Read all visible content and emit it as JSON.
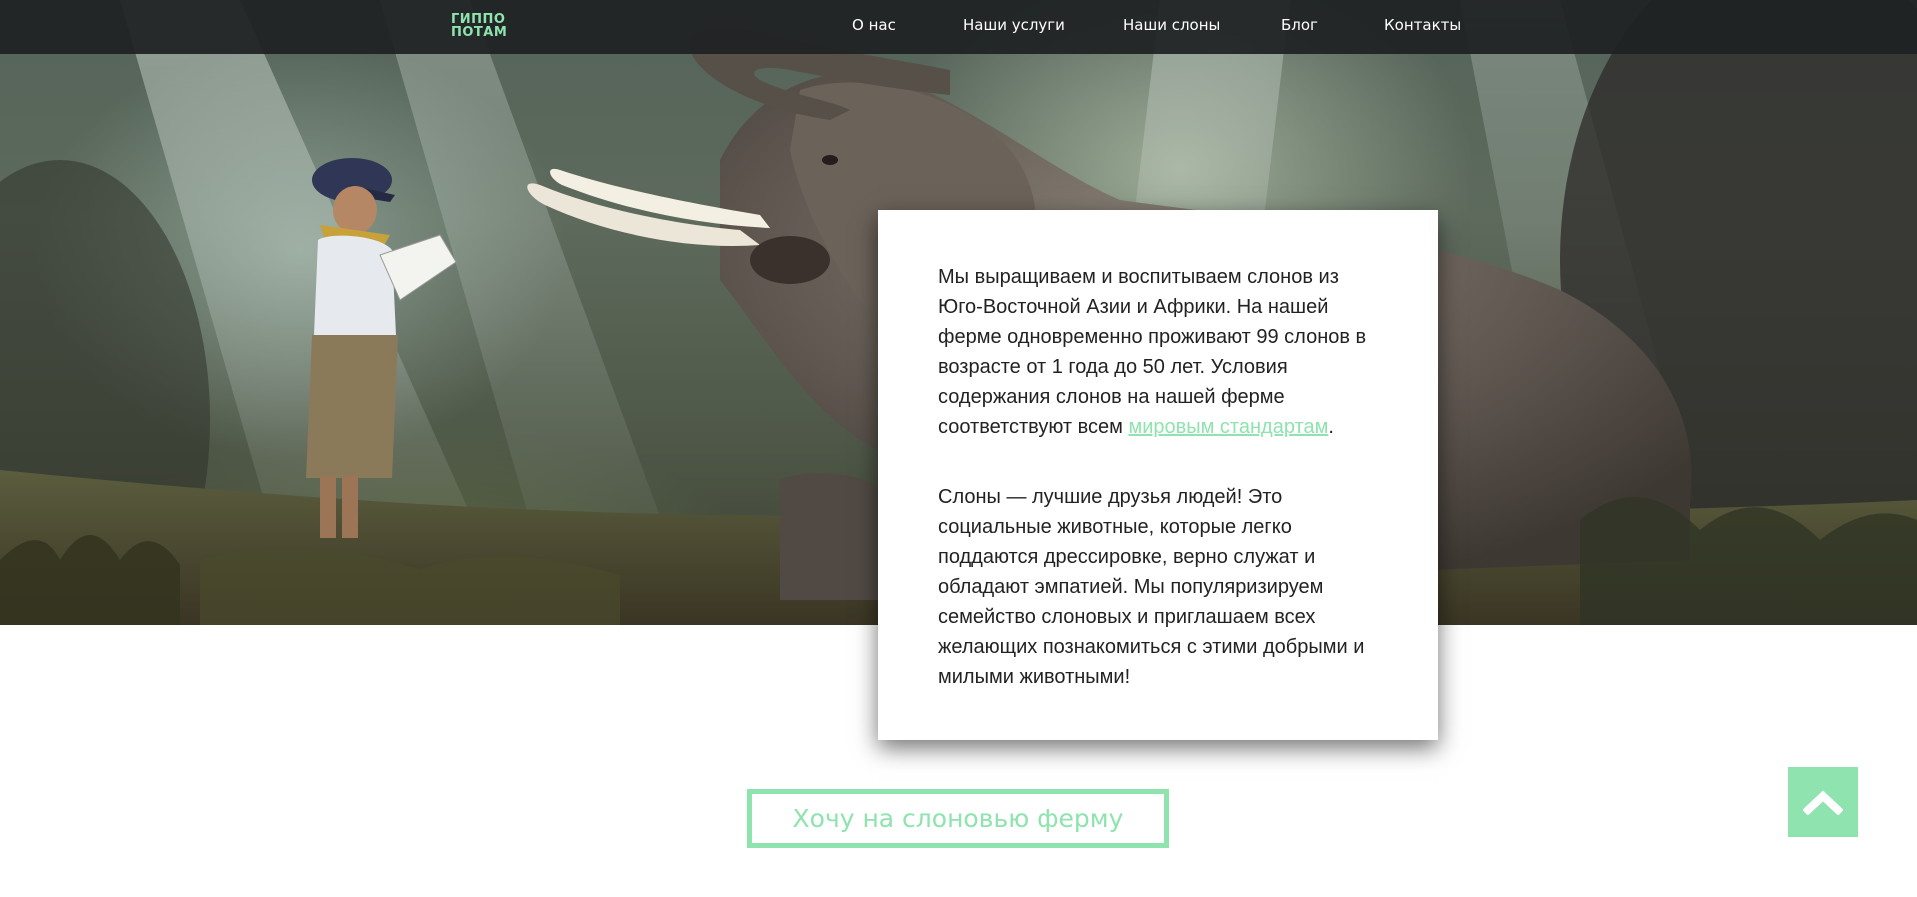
{
  "logo": {
    "line1": "ГИППО",
    "line2": "ПОТАМ"
  },
  "nav": {
    "items": [
      "О нас",
      "Наши услуги",
      "Наши слоны",
      "Блог",
      "Контакты"
    ]
  },
  "card": {
    "p1_text": "Мы выращиваем и воспитываем слонов из Юго-Восточной Азии и Африки. На нашей ферме одновременно проживают 99 слонов в возрасте от 1 года до 50 лет. Условия содержания слонов на нашей ферме соответствуют всем ",
    "p1_link": "мировым стандартам",
    "p1_end": ".",
    "p2_text": "Слоны — лучшие друзья людей! Это социальные животные, которые легко поддаются дрессировке, верно служат и обладают эмпатией. Мы популяризируем семейство слоновых и приглашаем всех желающих познакомиться с этими добрыми и милыми животными!"
  },
  "cta": {
    "label": "Хочу на слоновью ферму"
  },
  "icons": {
    "scroll_top": "chevron-up-icon"
  },
  "colors": {
    "accent": "#8ee3ae",
    "topbar": "#1e2122",
    "card_text": "#222222"
  }
}
